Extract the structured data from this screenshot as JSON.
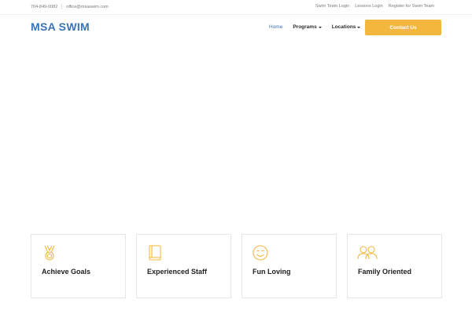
{
  "topbar": {
    "phone": "704-849-0082",
    "email": "office@msaswim.com",
    "links": [
      "Swim Team Login",
      "Lessons Login",
      "Register for Swim Team"
    ]
  },
  "header": {
    "logo": "MSA SWIM",
    "nav": [
      "Home",
      "Programs",
      "Locations"
    ],
    "cta": "Contact Us"
  },
  "features": [
    {
      "title": "Achieve Goals",
      "icon": "medal-icon"
    },
    {
      "title": "Experienced Staff",
      "icon": "book-icon"
    },
    {
      "title": "Fun Loving",
      "icon": "smile-icon"
    },
    {
      "title": "Family Oriented",
      "icon": "family-icon"
    }
  ],
  "colors": {
    "brand": "#3a73b6",
    "accent": "#f4b73e",
    "text": "#222222",
    "muted": "#7a7a7a"
  }
}
